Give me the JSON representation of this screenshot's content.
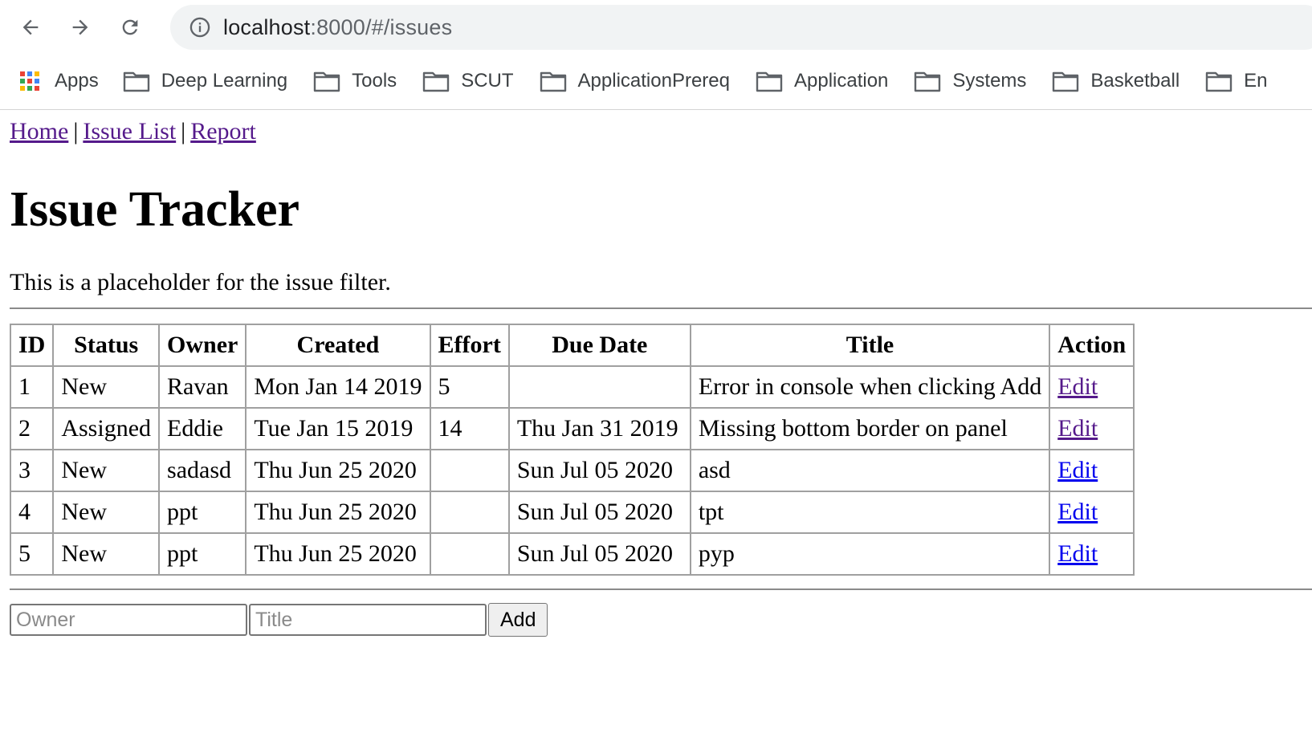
{
  "browser": {
    "url_host": "localhost",
    "url_rest": ":8000/#/issues",
    "bookmarks": [
      {
        "label": "Apps",
        "icon": "apps-grid-icon"
      },
      {
        "label": "Deep Learning",
        "icon": "folder-icon"
      },
      {
        "label": "Tools",
        "icon": "folder-icon"
      },
      {
        "label": "SCUT",
        "icon": "folder-icon"
      },
      {
        "label": "ApplicationPrereq",
        "icon": "folder-icon"
      },
      {
        "label": "Application",
        "icon": "folder-icon"
      },
      {
        "label": "Systems",
        "icon": "folder-icon"
      },
      {
        "label": "Basketball",
        "icon": "folder-icon"
      },
      {
        "label": "En",
        "icon": "folder-icon"
      }
    ]
  },
  "nav": {
    "home": "Home",
    "issue_list": "Issue List",
    "report": "Report",
    "separator": "|"
  },
  "page": {
    "title": "Issue Tracker",
    "filter_text": "This is a placeholder for the issue filter."
  },
  "table": {
    "headers": [
      "ID",
      "Status",
      "Owner",
      "Created",
      "Effort",
      "Due Date",
      "Title",
      "Action"
    ],
    "rows": [
      {
        "id": "1",
        "status": "New",
        "owner": "Ravan",
        "created": "Mon Jan 14 2019",
        "effort": "5",
        "due": "",
        "title": "Error in console when clicking Add",
        "action": "Edit"
      },
      {
        "id": "2",
        "status": "Assigned",
        "owner": "Eddie",
        "created": "Tue Jan 15 2019",
        "effort": "14",
        "due": "Thu Jan 31 2019",
        "title": "Missing bottom border on panel",
        "action": "Edit"
      },
      {
        "id": "3",
        "status": "New",
        "owner": "sadasd",
        "created": "Thu Jun 25 2020",
        "effort": "",
        "due": "Sun Jul 05 2020",
        "title": "asd",
        "action": "Edit"
      },
      {
        "id": "4",
        "status": "New",
        "owner": "ppt",
        "created": "Thu Jun 25 2020",
        "effort": "",
        "due": "Sun Jul 05 2020",
        "title": "tpt",
        "action": "Edit"
      },
      {
        "id": "5",
        "status": "New",
        "owner": "ppt",
        "created": "Thu Jun 25 2020",
        "effort": "",
        "due": "Sun Jul 05 2020",
        "title": "pyp",
        "action": "Edit"
      }
    ]
  },
  "form": {
    "owner_placeholder": "Owner",
    "title_placeholder": "Title",
    "owner_value": "",
    "title_value": "",
    "add_label": "Add"
  },
  "colors": {
    "link_visited": "#551a8b",
    "link_unvisited": "#0000ee",
    "omnibox_bg": "#f1f3f4"
  }
}
